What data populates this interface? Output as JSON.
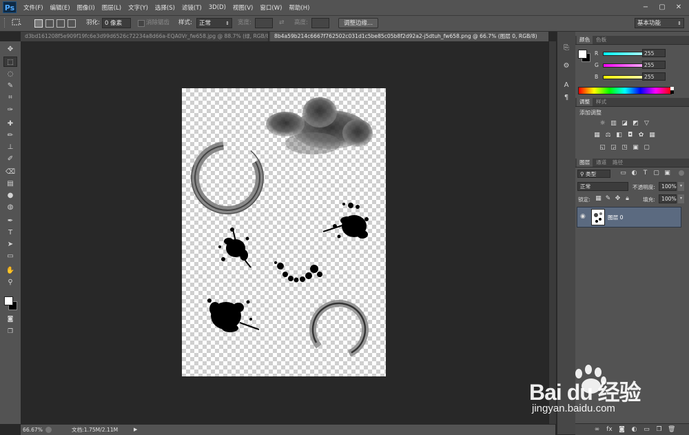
{
  "app": {
    "logo": "Ps"
  },
  "menubar": {
    "items": [
      "文件(F)",
      "编辑(E)",
      "图像(I)",
      "图层(L)",
      "文字(Y)",
      "选择(S)",
      "滤镜(T)",
      "3D(D)",
      "视图(V)",
      "窗口(W)",
      "帮助(H)"
    ],
    "window_controls": [
      "−",
      "▢",
      "✕"
    ]
  },
  "options": {
    "feather_label": "羽化:",
    "feather_value": "0 像素",
    "antialias_label": "消除锯齿",
    "style_label": "样式:",
    "style_value": "正常",
    "width_label": "宽度:",
    "height_label": "高度:",
    "refine_button": "调整边缘...",
    "workspace": "基本功能"
  },
  "tabs": [
    {
      "label": "d3bd161208f5e909f19fc6e3d99d6526c72234a8d66a-EQA0Vr_fw658.jpg @ 88.7% (绿, RGB/8)...",
      "active": false
    },
    {
      "label": "8b4a59b214c6667f762502c031d1c5be85c05b8f2d92a2-j5dtuh_fw658.png @ 66.7% (图层 0, RGB/8)",
      "active": true
    }
  ],
  "status": {
    "zoom": "66.67%",
    "doc_info": "文档:1.75M/2.11M"
  },
  "color_panel": {
    "tabs": [
      "颜色",
      "色板"
    ],
    "channels": [
      {
        "label": "R",
        "value": "255",
        "color": "#ff4d4d"
      },
      {
        "label": "G",
        "value": "255",
        "color": "#4dff4d"
      },
      {
        "label": "B",
        "value": "255",
        "color": "#4d4dff"
      }
    ]
  },
  "adjust_panel": {
    "tabs": [
      "调整",
      "样式"
    ],
    "title": "添加调整"
  },
  "layers_panel": {
    "tabs": [
      "图层",
      "通道",
      "路径"
    ],
    "filter_kind": "类型",
    "blend_mode": "正常",
    "opacity_label": "不透明度:",
    "opacity_value": "100%",
    "lock_label": "锁定:",
    "fill_label": "填充:",
    "fill_value": "100%",
    "layers": [
      {
        "name": "图层 0",
        "visible": true
      }
    ]
  },
  "watermark": {
    "brand": "Bai du 经验",
    "url": "jingyan.baidu.com"
  }
}
